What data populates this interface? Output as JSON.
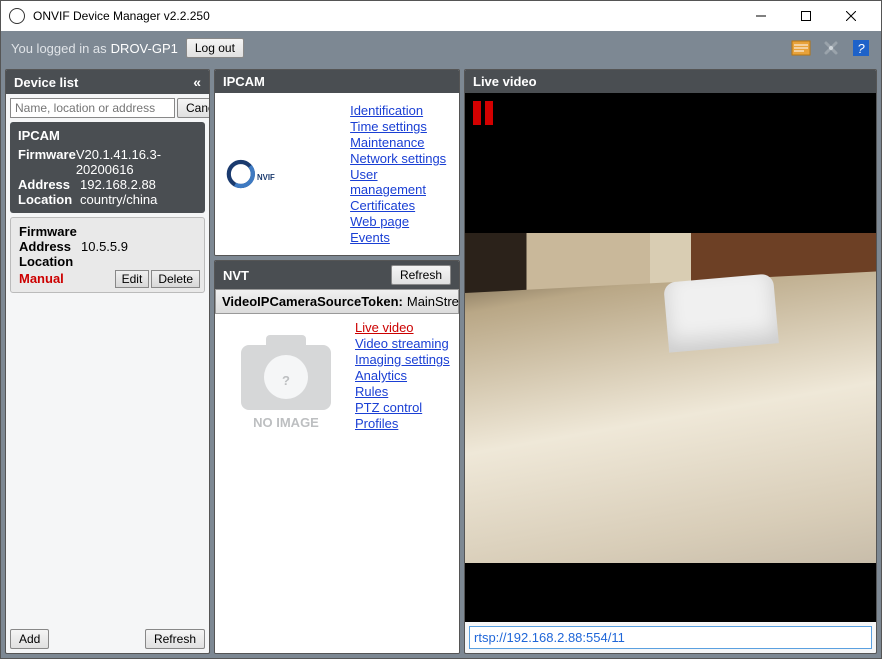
{
  "window": {
    "title": "ONVIF Device Manager v2.2.250"
  },
  "login": {
    "prefix": "You logged in as",
    "user": "DROV-GP1",
    "logout": "Log out"
  },
  "sidebar": {
    "header": "Device list",
    "search_placeholder": "Name, location or address",
    "cancel": "Cancel",
    "devices": [
      {
        "name": "IPCAM",
        "firmware_k": "Firmware",
        "firmware_v": "V20.1.41.16.3-20200616",
        "address_k": "Address",
        "address_v": "192.168.2.88",
        "location_k": "Location",
        "location_v": "country/china",
        "active": true
      },
      {
        "firmware_k": "Firmware",
        "firmware_v": "",
        "address_k": "Address",
        "address_v": "10.5.5.9",
        "location_k": "Location",
        "location_v": "",
        "manual": "Manual",
        "edit": "Edit",
        "del": "Delete",
        "active": false
      }
    ],
    "add": "Add",
    "refresh": "Refresh"
  },
  "ipcam": {
    "header": "IPCAM",
    "links": [
      "Identification",
      "Time settings",
      "Maintenance",
      "Network settings",
      "User management",
      "Certificates",
      "Web page",
      "Events"
    ]
  },
  "nvt": {
    "header": "NVT",
    "refresh": "Refresh",
    "token_k": "VideoIPCameraSourceToken:",
    "token_v": "MainStreamProfile",
    "noimage": "NO IMAGE",
    "links": [
      "Live video",
      "Video streaming",
      "Imaging settings",
      "Analytics",
      "Rules",
      "PTZ control",
      "Profiles"
    ],
    "active_link_index": 0
  },
  "live": {
    "header": "Live video",
    "url": "rtsp://192.168.2.88:554/11"
  }
}
